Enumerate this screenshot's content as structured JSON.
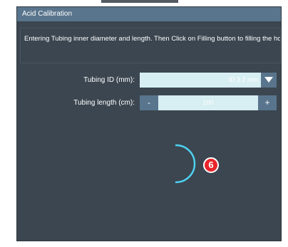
{
  "dialog": {
    "title": "Acid Calibration",
    "instruction": "Entering Tubing inner diameter and length. Then Click on Filling button to filling the hose."
  },
  "tubing_id": {
    "label": "Tubing ID (mm):",
    "value": "ID 3.2 mm"
  },
  "tubing_length": {
    "label": "Tubing length (cm):",
    "decrement_label": "-",
    "value": "100",
    "increment_label": "+"
  },
  "annotation": {
    "number": "6"
  },
  "colors": {
    "dialog_bg": "#3b4650",
    "titlebar_bg": "#59758d",
    "field_bg": "#d7eef2",
    "spinner": "#4fd1f0",
    "badge": "#e8242b"
  },
  "icons": {
    "dropdown": "triangle-down-icon",
    "loading": "loading-spinner-icon"
  }
}
